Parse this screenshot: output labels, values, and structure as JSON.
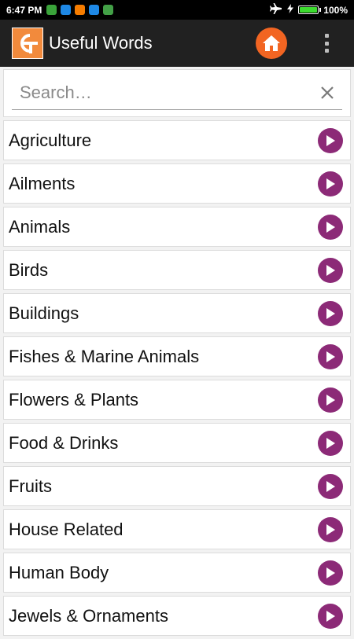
{
  "status_bar": {
    "time": "6:47 PM",
    "battery": "100%",
    "battery_level": 1.0,
    "notification_icons": [
      {
        "name": "green-app-icon",
        "color": "#3aa33a"
      },
      {
        "name": "blue-app-icon",
        "color": "#1e88e5"
      },
      {
        "name": "orange-app-icon",
        "color": "#f57c00"
      },
      {
        "name": "blue-download-icon",
        "color": "#1e88e5"
      },
      {
        "name": "android-icon",
        "color": "#43a047"
      }
    ]
  },
  "app_bar": {
    "title": "Useful Words",
    "home_icon": "home-icon",
    "menu_icon": "overflow-menu-icon",
    "home_color": "#f26522"
  },
  "search": {
    "placeholder": "Search…",
    "value": ""
  },
  "categories": [
    "Agriculture",
    "Ailments",
    "Animals",
    "Birds",
    "Buildings",
    "Fishes & Marine Animals",
    "Flowers & Plants",
    "Food & Drinks",
    "Fruits",
    "House Related",
    "Human Body",
    "Jewels & Ornaments"
  ],
  "colors": {
    "accent_arrow": "#8c2a77",
    "app_bar_bg": "#212121",
    "logo_bg": "#f28a3c"
  }
}
